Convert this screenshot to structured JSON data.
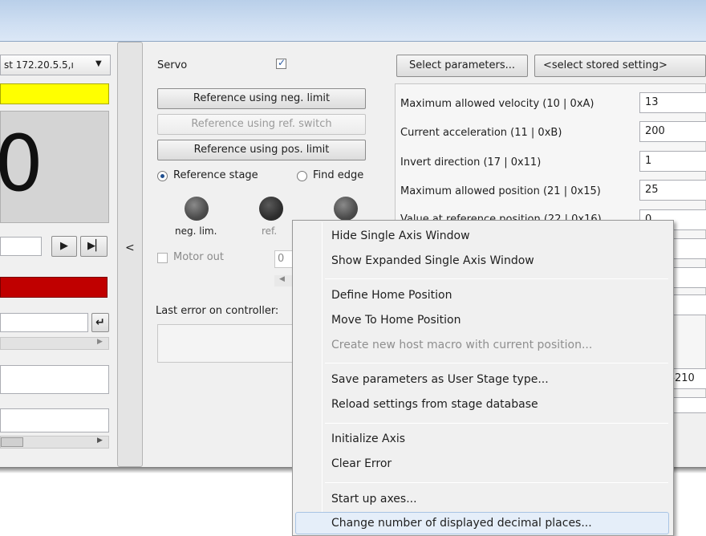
{
  "connection_dropdown": {
    "value": "st 172.20.5.5,ı"
  },
  "position_display": {
    "digit": "0"
  },
  "collapse_arrow": "<",
  "servo": {
    "label": "Servo",
    "checked": true
  },
  "buttons": {
    "ref_neg": "Reference using neg. limit",
    "ref_switch": "Reference using ref. switch",
    "ref_pos": "Reference using pos. limit",
    "select_params": "Select parameters...",
    "stored_setting": "<select stored setting>"
  },
  "radios": {
    "reference_stage": "Reference stage",
    "find_edge": "Find edge"
  },
  "leds": {
    "neg": "neg. lim.",
    "ref": "ref."
  },
  "motor_out": {
    "label": "Motor out"
  },
  "motor_value": "0",
  "last_error_label": "Last error on controller:",
  "params": [
    {
      "name": "Maximum allowed velocity  (10 | 0xA)",
      "value": "13"
    },
    {
      "name": "Current acceleration  (11 | 0xB)",
      "value": "200"
    },
    {
      "name": "Invert direction  (17 | 0x11)",
      "value": "1"
    },
    {
      "name": "Maximum allowed position  (21 | 0x15)",
      "value": "25"
    }
  ],
  "param_partial": {
    "name": "Value at reference position  (22 | 0x16)",
    "value": "0"
  },
  "stage_value_partial": "9-210",
  "colors": {
    "status_yellow": "#ffff00",
    "status_red": "#c00000",
    "menu_highlight": "#e5eef9"
  },
  "context_menu": {
    "items": [
      {
        "label": "Hide Single Axis Window",
        "enabled": true
      },
      {
        "label": "Show Expanded Single Axis Window",
        "enabled": true
      },
      {
        "label": "Define Home Position",
        "enabled": true
      },
      {
        "label": "Move To Home Position",
        "enabled": true
      },
      {
        "label": "Create new host macro with current position...",
        "enabled": false
      },
      {
        "label": "Save parameters as User Stage type...",
        "enabled": true
      },
      {
        "label": "Reload settings from stage database",
        "enabled": true
      },
      {
        "label": "Initialize Axis",
        "enabled": true
      },
      {
        "label": "Clear Error",
        "enabled": true
      },
      {
        "label": "Start up axes...",
        "enabled": true
      },
      {
        "label": "Change number of displayed decimal places...",
        "enabled": true,
        "highlighted": true
      }
    ]
  }
}
